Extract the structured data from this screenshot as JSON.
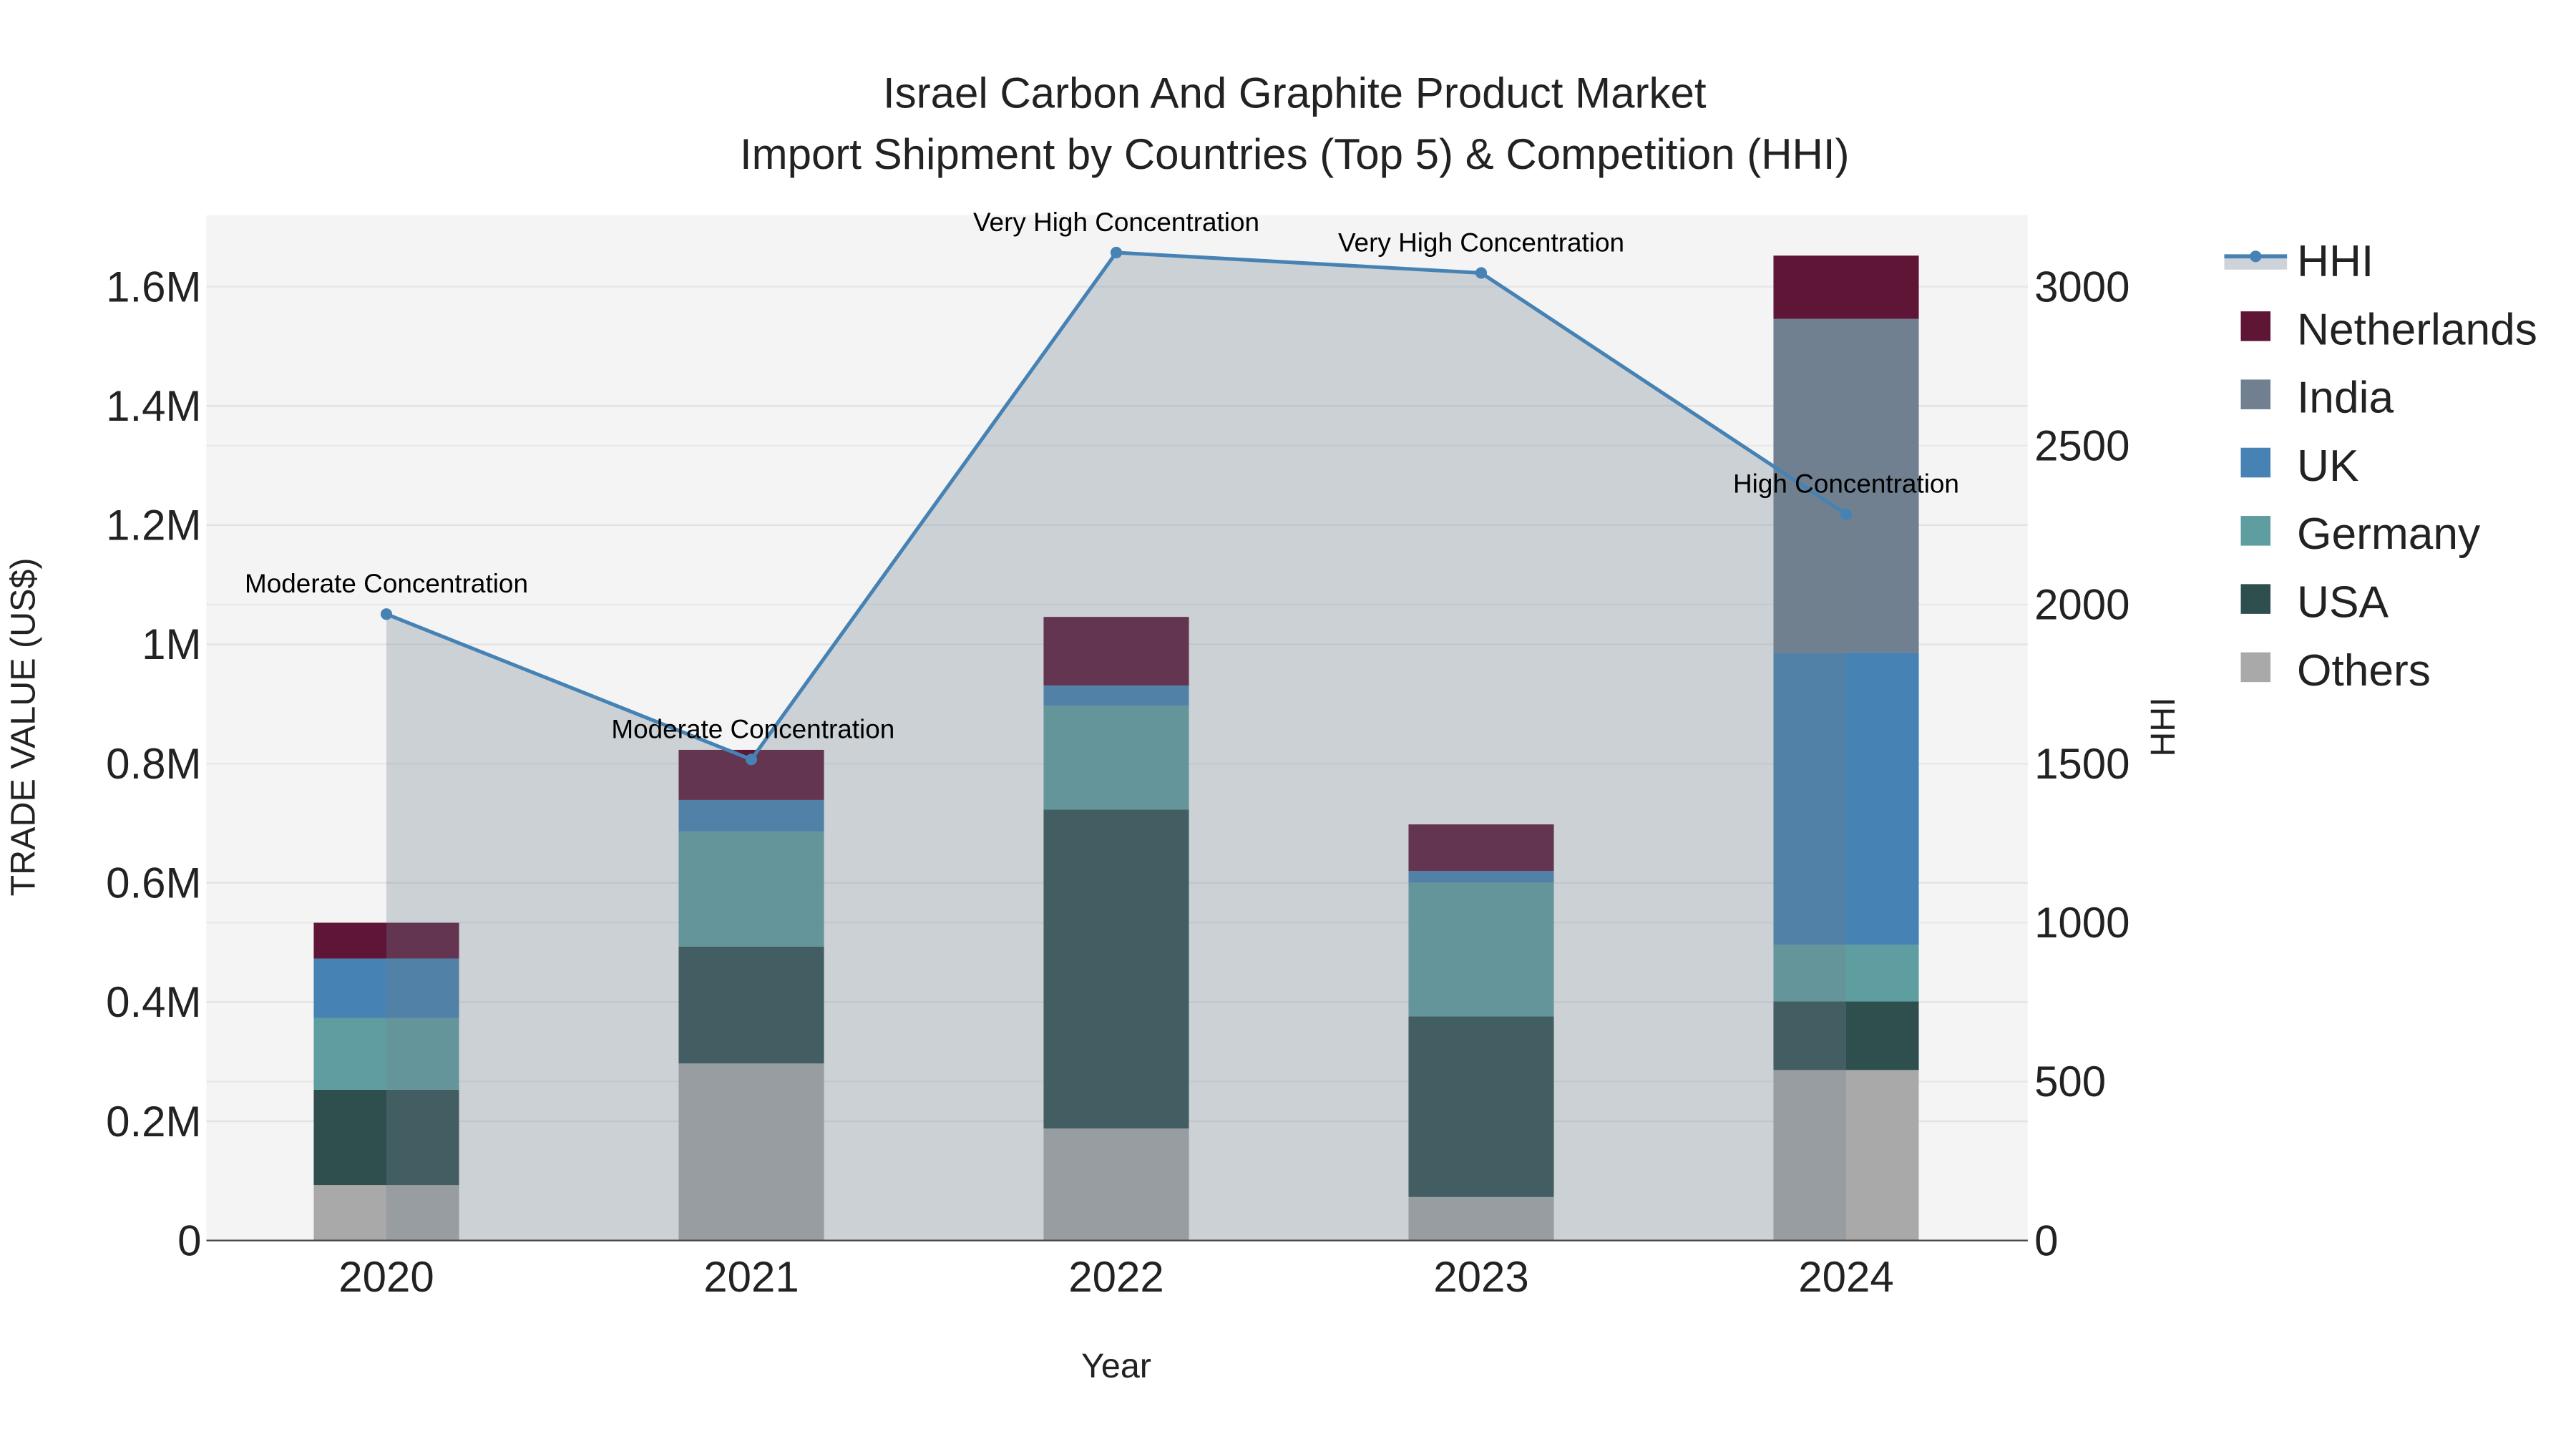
{
  "chart_data": {
    "type": "bar",
    "title": "Israel Carbon And Graphite Product Market",
    "subtitle": "Import Shipment by Countries (Top 5) & Competition (HHI)",
    "xlabel": "Year",
    "ylabel": "TRADE VALUE (US$)",
    "y2label": "HHI",
    "categories": [
      "2020",
      "2021",
      "2022",
      "2023",
      "2024"
    ],
    "ylim": [
      0,
      1720000
    ],
    "y2lim": [
      0,
      3225
    ],
    "yticks": [
      {
        "v": 0,
        "label": "0"
      },
      {
        "v": 200000,
        "label": "0.2M"
      },
      {
        "v": 400000,
        "label": "0.4M"
      },
      {
        "v": 600000,
        "label": "0.6M"
      },
      {
        "v": 800000,
        "label": "0.8M"
      },
      {
        "v": 1000000,
        "label": "1M"
      },
      {
        "v": 1200000,
        "label": "1.2M"
      },
      {
        "v": 1400000,
        "label": "1.4M"
      },
      {
        "v": 1600000,
        "label": "1.6M"
      }
    ],
    "y2ticks": [
      {
        "v": 0,
        "label": "0"
      },
      {
        "v": 500,
        "label": "500"
      },
      {
        "v": 1000,
        "label": "1000"
      },
      {
        "v": 1500,
        "label": "1500"
      },
      {
        "v": 2000,
        "label": "2000"
      },
      {
        "v": 2500,
        "label": "2500"
      },
      {
        "v": 3000,
        "label": "3000"
      }
    ],
    "series": [
      {
        "name": "Others",
        "color": "#a9a9a9",
        "values": [
          93000,
          297000,
          188000,
          73000,
          286000
        ]
      },
      {
        "name": "USA",
        "color": "#2f4f4f",
        "values": [
          160000,
          196000,
          535000,
          303000,
          115000
        ]
      },
      {
        "name": "Germany",
        "color": "#5f9ea0",
        "values": [
          120000,
          193000,
          174000,
          224000,
          95000
        ]
      },
      {
        "name": "UK",
        "color": "#4682b4",
        "values": [
          100000,
          53000,
          34000,
          20000,
          490000
        ]
      },
      {
        "name": "India",
        "color": "#708090",
        "values": [
          0,
          0,
          0,
          0,
          560000
        ]
      },
      {
        "name": "Netherlands",
        "color": "#5f1535",
        "values": [
          60000,
          84000,
          115000,
          78000,
          106000
        ]
      }
    ],
    "hhi": {
      "name": "HHI",
      "color": "#4682b4",
      "values": [
        1970,
        1513,
        3107,
        3043,
        2284
      ],
      "annotations": [
        "Moderate Concentration",
        "Moderate Concentration",
        "Very High Concentration",
        "Very High Concentration",
        "High Concentration"
      ]
    },
    "legend": [
      "HHI",
      "Netherlands",
      "India",
      "UK",
      "Germany",
      "USA",
      "Others"
    ],
    "legend_position": "right",
    "grid": true
  }
}
